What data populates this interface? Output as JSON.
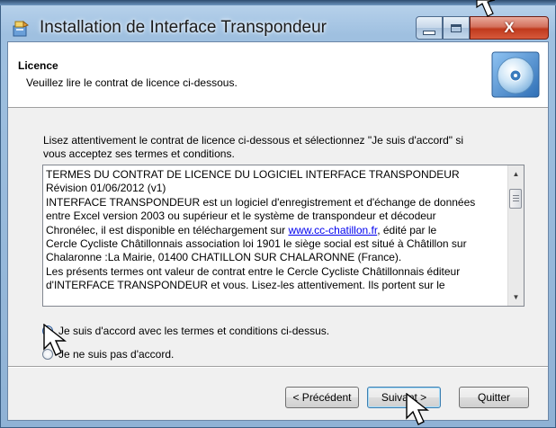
{
  "window": {
    "title": "Installation de Interface Transpondeur",
    "controls": {
      "minimize": "minimize-button",
      "maximize": "maximize-button",
      "close_glyph": "X"
    }
  },
  "header": {
    "title": "Licence",
    "subtitle": "Veuillez lire le contrat de licence ci-dessous.",
    "icon": "cd-disc-icon"
  },
  "intro_lines": [
    "Lisez attentivement le contrat de licence ci-dessous et sélectionnez \"Je suis d'accord\" si",
    "vous acceptez ses termes et conditions."
  ],
  "license": {
    "lines": [
      " TERMES DU CONTRAT DE LICENCE DU LOGICIEL INTERFACE TRANSPONDEUR",
      "Révision 01/06/2012 (v1)",
      "INTERFACE TRANSPONDEUR est un logiciel d'enregistrement et d'échange de données",
      "entre Excel version 2003 ou supérieur et le système de transpondeur et décodeur"
    ],
    "line5_before_link": "Chronélec,  il est disponible en téléchargement sur ",
    "link_text": "www.cc-chatillon.fr",
    "line5_after_link": ", édité par le",
    "lines_rest": [
      "Cercle Cycliste Châtillonnais association loi 1901 le siège social est situé à Châtillon sur",
      "Chalaronne :La Mairie, 01400 CHATILLON SUR CHALARONNE (France).",
      "Les présents termes ont valeur de contrat entre le Cercle Cycliste Châtillonnais éditeur",
      "d'INTERFACE TRANSPONDEUR et vous. Lisez-les attentivement. Ils portent sur le"
    ]
  },
  "options": {
    "accept": "Je suis d'accord avec les termes et conditions ci-dessus.",
    "decline": "Je ne suis pas d'accord.",
    "selected": "accept"
  },
  "buttons": {
    "previous": "< Précédent",
    "next": "Suivant >",
    "quit": "Quitter"
  },
  "colors": {
    "link": "#0000ee",
    "close_button": "#c0391c",
    "frame": "#9fc0e0"
  }
}
